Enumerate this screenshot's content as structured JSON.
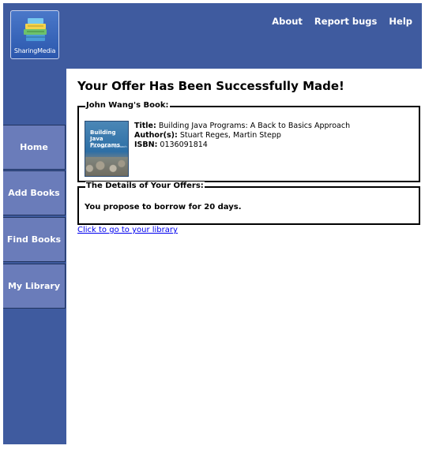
{
  "app": {
    "logo_text": "SharingMedia"
  },
  "topnav": {
    "items": [
      "About",
      "Report bugs",
      "Help"
    ]
  },
  "sidebar": {
    "items": [
      {
        "label": "Home"
      },
      {
        "label": "Add Books"
      },
      {
        "label": "Find Books"
      },
      {
        "label": "My Library"
      }
    ]
  },
  "main": {
    "title": "Your Offer Has Been Successfully Made!",
    "book_section": {
      "legend": "John Wang's Book:",
      "cover_title_line1": "Building",
      "cover_title_line2": "Java",
      "cover_title_line3": "Programs",
      "cover_subtitle": "A Back to Basics Approach",
      "title_label": "Title:",
      "title_value": "Building Java Programs: A Back to Basics Approach",
      "author_label": "Author(s):",
      "author_value": "Stuart Reges, Martin Stepp",
      "isbn_label": "ISBN:",
      "isbn_value": "0136091814"
    },
    "details_section": {
      "legend": "The Details of Your Offers:",
      "proposal_text": "You propose to borrow for 20 days."
    },
    "library_link": "Click to go to your library"
  },
  "colors": {
    "header_bg": "#3f5b9f",
    "sidebar_item_bg": "#6a7cba",
    "link": "#0000ee"
  }
}
